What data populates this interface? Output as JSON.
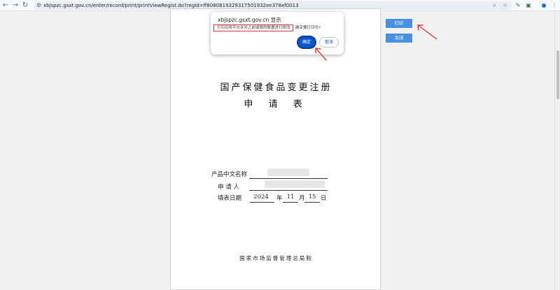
{
  "browser": {
    "url": "xbjspzc.gsxt.gov.cn/enter/record/print/printViewRegist.do?regId=ff8080819329317501932ee378ef0013",
    "icons": [
      "back-icon",
      "forward-icon",
      "reload-icon",
      "site-info-icon",
      "zoom-icon",
      "bookmark-star-icon",
      "extension-icon",
      "extensions-puzzle-icon",
      "profile-icon",
      "menu-icon"
    ]
  },
  "document": {
    "title": "国产保健食品变更注册",
    "subtitle": "申 请 表",
    "fields": {
      "product_name_label": "产品中文名称",
      "applicant_label": "申 请 人",
      "date_label": "填表日期"
    },
    "date": {
      "year": "2024",
      "year_unit": "年",
      "month": "11",
      "month_unit": "月",
      "day": "15",
      "day_unit": "日"
    },
    "issuer": "国家市场监督管理总局制"
  },
  "side_buttons": {
    "print_label": "打印",
    "close_label": "关闭"
  },
  "dialog": {
    "title": "xbjspzc.gsxt.gov.cn 显示",
    "message_highlighted": "打印后将不允许对之前填报的数据进行修改",
    "message_rest": "确定要打印吗?",
    "ok_label": "确定",
    "cancel_label": "取消"
  },
  "colors": {
    "accent_button": "#4a8fe3",
    "dialog_primary": "#0b57d0",
    "annotation": "#e53935"
  }
}
